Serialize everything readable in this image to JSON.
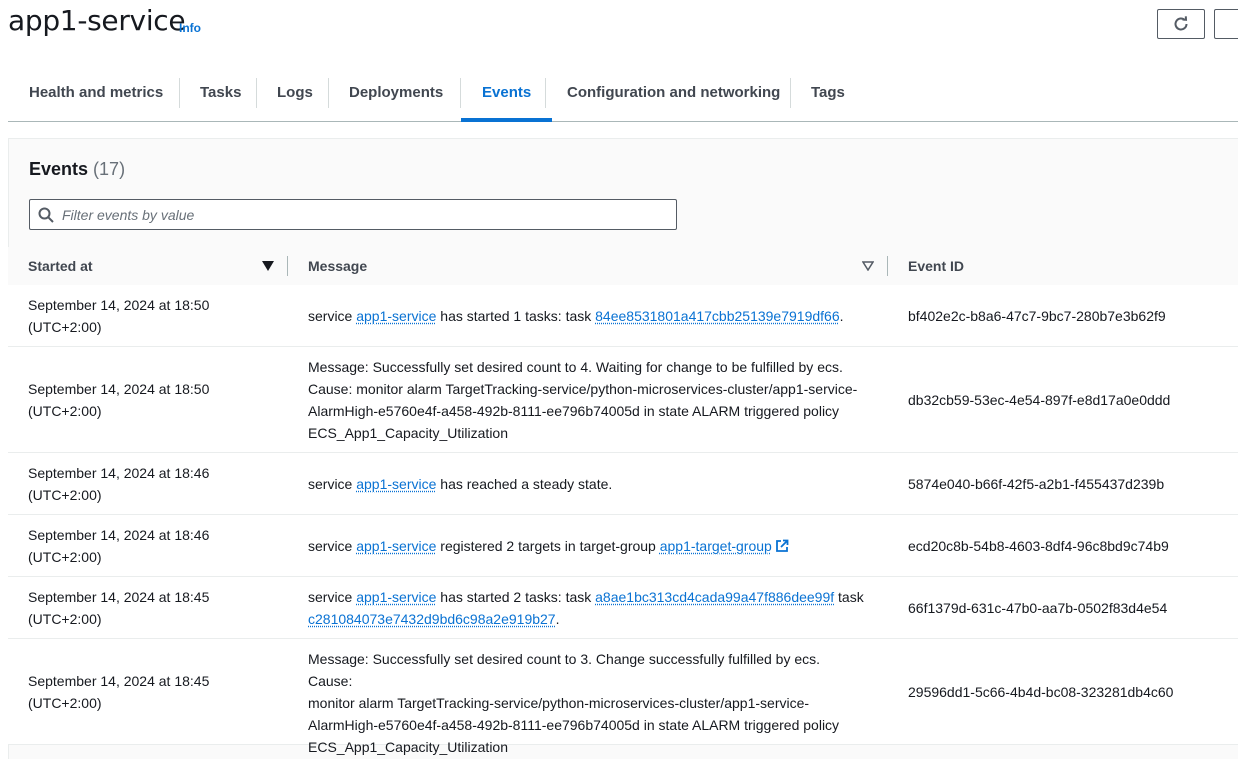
{
  "header": {
    "title": "app1-service",
    "info_label": "Info"
  },
  "tabs": [
    {
      "label": "Health and metrics"
    },
    {
      "label": "Tasks"
    },
    {
      "label": "Logs"
    },
    {
      "label": "Deployments"
    },
    {
      "label": "Events",
      "active": true
    },
    {
      "label": "Configuration and networking"
    },
    {
      "label": "Tags"
    }
  ],
  "events": {
    "title": "Events",
    "count": "(17)",
    "filter_placeholder": "Filter events by value",
    "columns": {
      "started_at": "Started at",
      "message": "Message",
      "event_id": "Event ID"
    },
    "rows": [
      {
        "time_line1": "September 14, 2024 at 18:50",
        "time_line2": "(UTC+2:00)",
        "msg": {
          "t1": "service ",
          "l1": "app1-service",
          "t2": " has started 1 tasks: task ",
          "l2": "84ee8531801a417cbb25139e7919df66",
          "t3": "."
        },
        "id": "bf402e2c-b8a6-47c7-9bc7-280b7e3b62f9"
      },
      {
        "time_line1": "September 14, 2024 at 18:50",
        "time_line2": "(UTC+2:00)",
        "msg_lines": [
          "Message: Successfully set desired count to 4. Waiting for change to be fulfilled by ecs.",
          "Cause: monitor alarm TargetTracking-service/python-microservices-cluster/app1-service-",
          "AlarmHigh-e5760e4f-a458-492b-8111-ee796b74005d in state ALARM triggered policy",
          "ECS_App1_Capacity_Utilization"
        ],
        "id": "db32cb59-53ec-4e54-897f-e8d17a0e0ddd"
      },
      {
        "time_line1": "September 14, 2024 at 18:46",
        "time_line2": "(UTC+2:00)",
        "msg": {
          "t1": "service ",
          "l1": "app1-service",
          "t2": " has reached a steady state."
        },
        "id": "5874e040-b66f-42f5-a2b1-f455437d239b"
      },
      {
        "time_line1": "September 14, 2024 at 18:46",
        "time_line2": "(UTC+2:00)",
        "msg": {
          "t1": "service ",
          "l1": "app1-service",
          "t2": " registered 2 targets in target-group ",
          "l2": "app1-target-group"
        },
        "id": "ecd20c8b-54b8-4603-8df4-96c8bd9c74b9"
      },
      {
        "time_line1": "September 14, 2024 at 18:45",
        "time_line2": "(UTC+2:00)",
        "msg": {
          "t1": "service ",
          "l1": "app1-service",
          "t2": " has started 2 tasks: task ",
          "l2": "a8ae1bc313cd4cada99a47f886dee99f",
          "t3": " task ",
          "l3": "c281084073e7432d9bd6c98a2e919b27",
          "t4": "."
        },
        "id": "66f1379d-631c-47b0-aa7b-0502f83d4e54"
      },
      {
        "time_line1": "September 14, 2024 at 18:45",
        "time_line2": "(UTC+2:00)",
        "msg_lines": [
          "Message: Successfully set desired count to 3. Change successfully fulfilled by ecs. Cause:",
          "monitor alarm TargetTracking-service/python-microservices-cluster/app1-service-",
          "AlarmHigh-e5760e4f-a458-492b-8111-ee796b74005d in state ALARM triggered policy",
          "ECS_App1_Capacity_Utilization"
        ],
        "id": "29596dd1-5c66-4b4d-bc08-323281db4c60"
      }
    ]
  }
}
